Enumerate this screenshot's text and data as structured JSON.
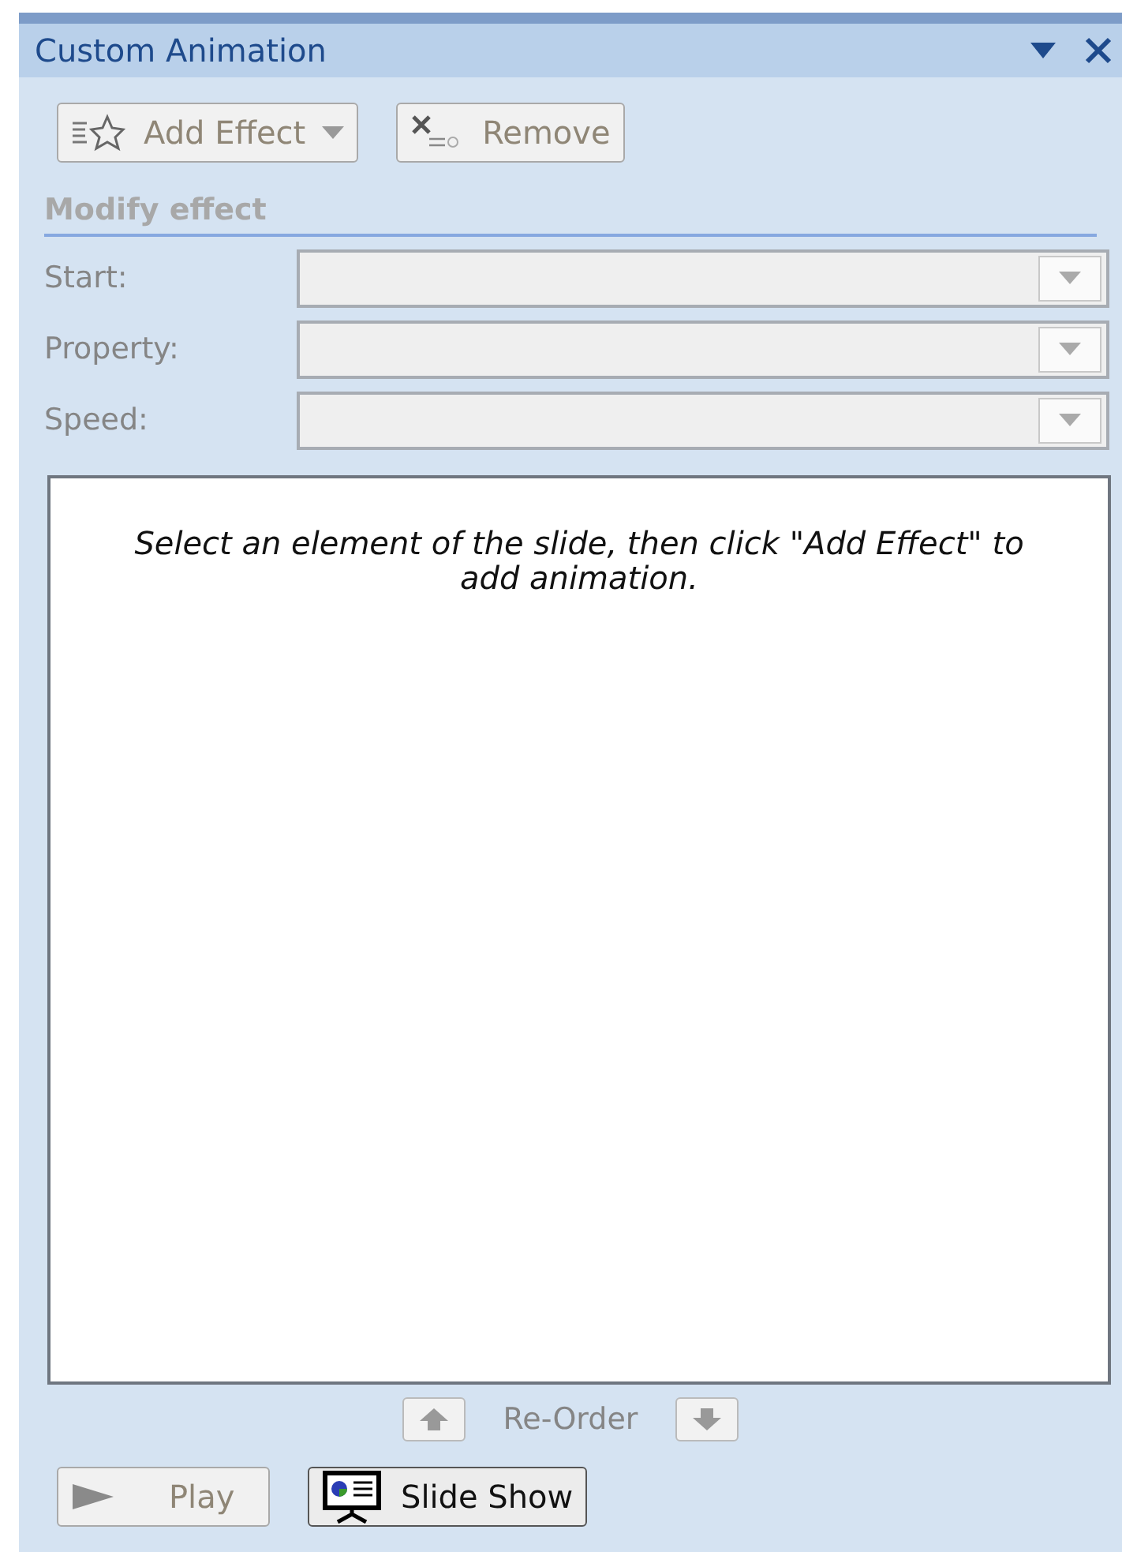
{
  "pane": {
    "title": "Custom Animation"
  },
  "toolbar": [
    {
      "kind": "add",
      "label": "Add Effect",
      "disabled": true
    },
    {
      "kind": "remove",
      "label": "Remove",
      "disabled": true
    }
  ],
  "section": "Modify effect",
  "fields": [
    {
      "label": "Start:",
      "disabled": true
    },
    {
      "label": "Property:",
      "disabled": true
    },
    {
      "label": "Speed:",
      "disabled": true
    }
  ],
  "effects_list": {
    "message": "Select an element of the slide, then click \"Add Effect\" to add animation."
  },
  "reorder": {
    "label": "Re-Order",
    "disabled": true
  },
  "footer": [
    {
      "kind": "play",
      "label": "Play",
      "disabled": true
    },
    {
      "kind": "slideshow",
      "label": "Slide Show",
      "disabled": false
    }
  ]
}
